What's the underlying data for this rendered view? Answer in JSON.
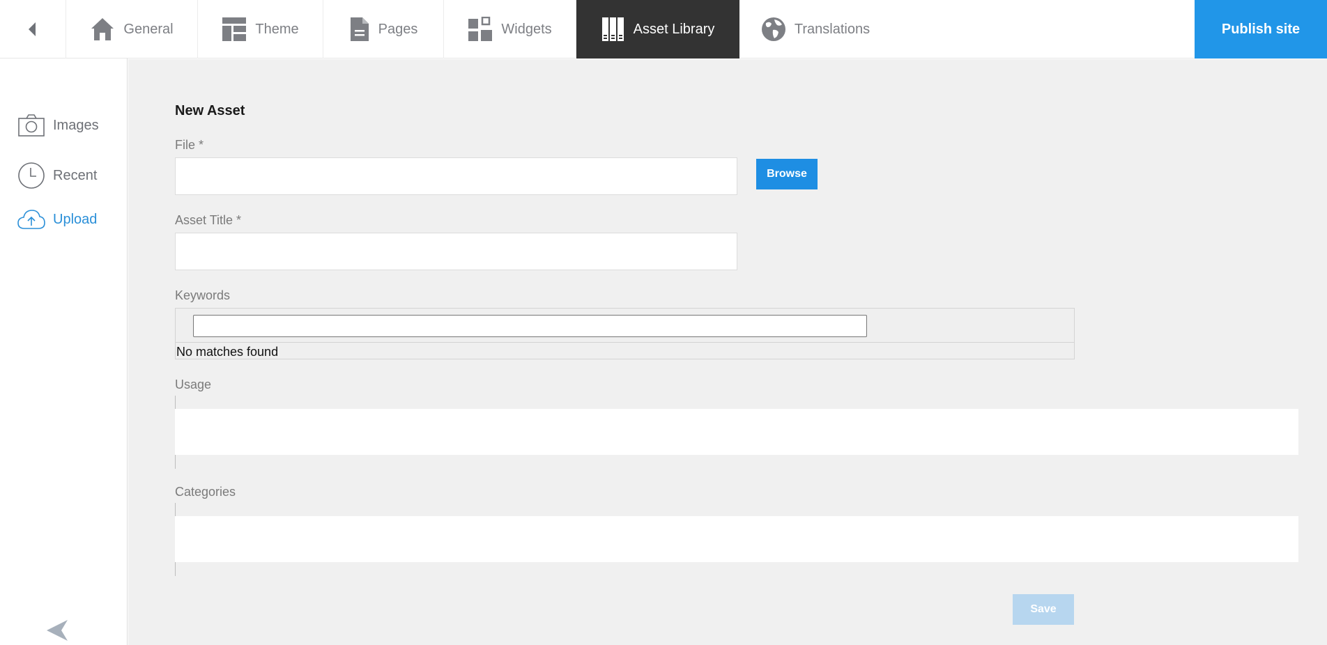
{
  "topbar": {
    "back_icon": "chevron-left-icon",
    "tabs": [
      {
        "label": "General",
        "icon": "home-icon"
      },
      {
        "label": "Theme",
        "icon": "layout-icon"
      },
      {
        "label": "Pages",
        "icon": "document-icon"
      },
      {
        "label": "Widgets",
        "icon": "widgets-icon"
      },
      {
        "label": "Asset Library",
        "icon": "library-icon",
        "active": true
      },
      {
        "label": "Translations",
        "icon": "globe-icon"
      }
    ],
    "publish_label": "Publish site",
    "accent_color": "#2196e8",
    "active_tab_color": "#333333"
  },
  "sidebar": {
    "items": [
      {
        "label": "Images",
        "icon": "camera-icon"
      },
      {
        "label": "Recent",
        "icon": "clock-icon"
      },
      {
        "label": "Upload",
        "icon": "cloud-upload-icon",
        "active": true
      }
    ],
    "collapse_icon": "send-arrow-icon"
  },
  "form": {
    "title": "New Asset",
    "file_label": "File *",
    "file_value": "",
    "browse_label": "Browse",
    "asset_title_label": "Asset Title *",
    "asset_title_value": "",
    "keywords_label": "Keywords",
    "keywords_value": "",
    "keywords_empty": "No matches found",
    "usage_label": "Usage",
    "categories_label": "Categories",
    "save_label": "Save"
  }
}
